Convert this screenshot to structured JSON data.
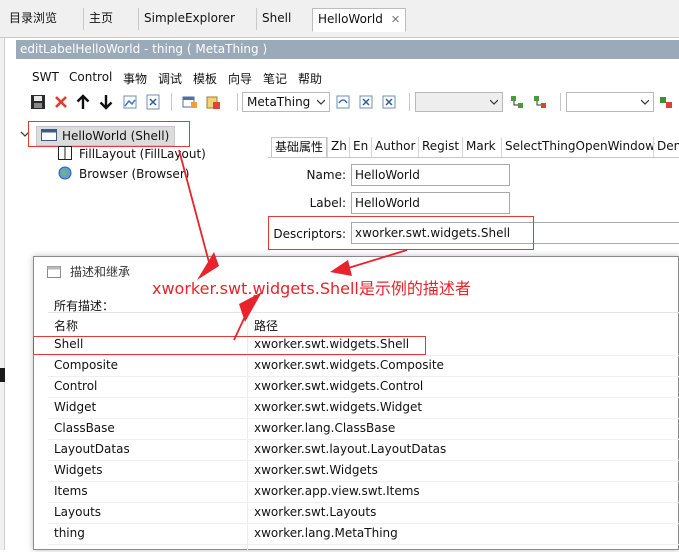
{
  "tabs": [
    {
      "label": "目录浏览"
    },
    {
      "label": "主页"
    },
    {
      "label": "SimpleExplorer"
    },
    {
      "label": "Shell"
    },
    {
      "label": "HelloWorld",
      "close": "✕"
    }
  ],
  "editor_title": "editLabelHelloWorld - thing ( MetaThing )",
  "menu": [
    "SWT",
    "Control",
    "事物",
    "调试",
    "模板",
    "向导",
    "笔记",
    "帮助"
  ],
  "toolbar": {
    "icons": [
      "save-icon",
      "delete-icon",
      "move-up-icon",
      "move-down-icon",
      "image-icon",
      "xml-icon",
      "window-icon",
      "package-icon"
    ],
    "thing_combo": "MetaThing",
    "combo2": "",
    "combo3": ""
  },
  "tree": {
    "root": "HelloWorld (Shell)",
    "children": [
      "FillLayout (FillLayout)",
      "Browser (Browser)"
    ]
  },
  "prop_tabs": [
    "基础属性",
    "Zh",
    "En",
    "Author",
    "Regist",
    "Mark",
    "SelectThingOpenWindow",
    "Den"
  ],
  "form": {
    "name_label": "Name:",
    "name_value": "HelloWorld",
    "label_label": "Label:",
    "label_value": "HelloWorld",
    "descriptors_label": "Descriptors:",
    "descriptors_value": "xworker.swt.widgets.Shell"
  },
  "dialog": {
    "title": "描述和继承",
    "group_label": "所有描述：",
    "columns": [
      "名称",
      "路径"
    ],
    "rows": [
      {
        "name": "Shell",
        "path": "xworker.swt.widgets.Shell"
      },
      {
        "name": "Composite",
        "path": "xworker.swt.widgets.Composite"
      },
      {
        "name": "Control",
        "path": "xworker.swt.widgets.Control"
      },
      {
        "name": "Widget",
        "path": "xworker.swt.widgets.Widget"
      },
      {
        "name": "ClassBase",
        "path": "xworker.lang.ClassBase"
      },
      {
        "name": "LayoutDatas",
        "path": "xworker.swt.layout.LayoutDatas"
      },
      {
        "name": "Widgets",
        "path": "xworker.swt.Widgets"
      },
      {
        "name": "Items",
        "path": "xworker.app.view.swt.Items"
      },
      {
        "name": "Layouts",
        "path": "xworker.swt.Layouts"
      },
      {
        "name": "thing",
        "path": "xworker.lang.MetaThing"
      }
    ]
  },
  "annotation": "xworker.swt.widgets.Shell是示例的描述者",
  "colors": {
    "annotation": "#e8232b",
    "title_bar": "#9aaab8"
  }
}
